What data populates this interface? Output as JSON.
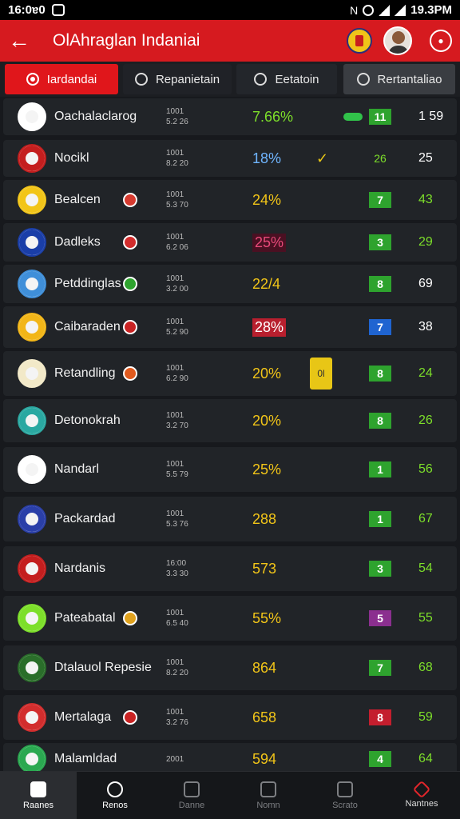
{
  "status_bar": {
    "time_left": "16:0ɐ0",
    "time_right": "19.3PM"
  },
  "app_bar": {
    "title": "OlAhraglan Indaniai"
  },
  "tabs": [
    {
      "label": "Iardandai"
    },
    {
      "label": "Repanietain"
    },
    {
      "label": "Eetatoin"
    },
    {
      "label": "Rertantaliao"
    }
  ],
  "rows": [
    {
      "name": "Oachalaclarog",
      "meta1": "1001",
      "meta2": "5.2 26",
      "pct": "7.66%",
      "pct_color": "#7ddf2a",
      "pct_bg": "",
      "badge": "11",
      "badge_color": "#2ea32e",
      "num": "1 59",
      "num_color": "#ffffff",
      "logo_color": "#ffffff",
      "flag_color": "",
      "extra_color": "#31c24a"
    },
    {
      "name": "Nocikl",
      "meta1": "1001",
      "meta2": "8.2 20",
      "pct": "18%",
      "pct_color": "#6fb5ff",
      "pct_bg": "",
      "badge": "26",
      "badge_color": "",
      "num": "25",
      "num_color": "#ffffff",
      "logo_color": "#c41e1e",
      "flag_color": "",
      "extra_color": ""
    },
    {
      "name": "Bealcen",
      "meta1": "1001",
      "meta2": "5.3 70",
      "pct": "24%",
      "pct_color": "#f2c518",
      "pct_bg": "",
      "badge": "7",
      "badge_color": "#2ea32e",
      "num": "43",
      "num_color": "#7ddf2a",
      "logo_color": "#f2c518",
      "flag_color": "#d63a2f",
      "extra_color": ""
    },
    {
      "name": "Dadleks",
      "meta1": "1001",
      "meta2": "6.2 06",
      "pct": "25%",
      "pct_color": "#e84a7a",
      "pct_bg": "#4a1022",
      "badge": "3",
      "badge_color": "#2ea32e",
      "num": "29",
      "num_color": "#7ddf2a",
      "logo_color": "#1a3ea8",
      "flag_color": "#d22d2d",
      "extra_color": ""
    },
    {
      "name": "Petddinglas",
      "meta1": "1001",
      "meta2": "3.2 00",
      "pct": "22/4",
      "pct_color": "#f2c518",
      "pct_bg": "",
      "badge": "8",
      "badge_color": "#2ea32e",
      "num": "69",
      "num_color": "#ffffff",
      "logo_color": "#3f8fd9",
      "flag_color": "#2ea32e",
      "extra_color": ""
    },
    {
      "name": "Caibaraden",
      "meta1": "1001",
      "meta2": "5.2 90",
      "pct": "28%",
      "pct_color": "#ffffff",
      "pct_bg": "#b81f2e",
      "badge": "7",
      "badge_color": "#1f64d1",
      "num": "38",
      "num_color": "#ffffff",
      "logo_color": "#f2b618",
      "flag_color": "#c92323",
      "extra_color": ""
    },
    {
      "name": "Retandling",
      "meta1": "1001",
      "meta2": "6.2 90",
      "pct": "20%",
      "pct_color": "#f2c518",
      "pct_bg": "",
      "badge": "8",
      "badge_color": "#2ea32e",
      "num": "24",
      "num_color": "#7ddf2a",
      "logo_color": "#f2e9c8",
      "flag_color": "#e05a1e",
      "extra_color": "",
      "mid": "0l"
    },
    {
      "name": "Detonokrah",
      "meta1": "1001",
      "meta2": "3.2 70",
      "pct": "20%",
      "pct_color": "#f2c518",
      "pct_bg": "",
      "badge": "8",
      "badge_color": "#2ea32e",
      "num": "26",
      "num_color": "#7ddf2a",
      "logo_color": "#2aa8a1",
      "flag_color": "",
      "extra_color": ""
    },
    {
      "name": "Nandarl",
      "meta1": "1001",
      "meta2": "5.5 79",
      "pct": "25%",
      "pct_color": "#f2c518",
      "pct_bg": "",
      "badge": "1",
      "badge_color": "#2ea32e",
      "num": "56",
      "num_color": "#7ddf2a",
      "logo_color": "#ffffff",
      "flag_color": "",
      "extra_color": ""
    },
    {
      "name": "Packardad",
      "meta1": "1001",
      "meta2": "5.3 76",
      "pct": "288",
      "pct_color": "#f2c518",
      "pct_bg": "",
      "badge": "1",
      "badge_color": "#2ea32e",
      "num": "67",
      "num_color": "#7ddf2a",
      "logo_color": "#2a3fa8",
      "flag_color": "",
      "extra_color": ""
    },
    {
      "name": "Nardanis",
      "meta1": "16:00",
      "meta2": "3.3 30",
      "pct": "573",
      "pct_color": "#f2c518",
      "pct_bg": "",
      "badge": "3",
      "badge_color": "#2ea32e",
      "num": "54",
      "num_color": "#7ddf2a",
      "logo_color": "#c41e1e",
      "flag_color": "",
      "extra_color": ""
    },
    {
      "name": "Pateabatal",
      "meta1": "1001",
      "meta2": "6.5 40",
      "pct": "55%",
      "pct_color": "#f2c518",
      "pct_bg": "",
      "badge": "5",
      "badge_color": "#8b2f8f",
      "num": "55",
      "num_color": "#7ddf2a",
      "logo_color": "#7ddf2a",
      "flag_color": "#e0a21e",
      "extra_color": ""
    },
    {
      "name": "Dtalauol Repesie",
      "meta1": "1001",
      "meta2": "8.2 20",
      "pct": "864",
      "pct_color": "#f2c518",
      "pct_bg": "",
      "badge": "7",
      "badge_color": "#2ea32e",
      "num": "68",
      "num_color": "#7ddf2a",
      "logo_color": "#2a6e2a",
      "flag_color": "",
      "extra_color": ""
    },
    {
      "name": "Mertalaga",
      "meta1": "1001",
      "meta2": "3.2 76",
      "pct": "658",
      "pct_color": "#f2c518",
      "pct_bg": "",
      "badge": "8",
      "badge_color": "#c41e2e",
      "num": "59",
      "num_color": "#7ddf2a",
      "logo_color": "#d22d2d",
      "flag_color": "#c92323",
      "extra_color": ""
    },
    {
      "name": "Malamldad",
      "meta1": "2001",
      "meta2": "",
      "pct": "594",
      "pct_color": "#f2c518",
      "pct_bg": "",
      "badge": "4",
      "badge_color": "#2ea32e",
      "num": "64",
      "num_color": "#7ddf2a",
      "logo_color": "#2aa850",
      "flag_color": "",
      "extra_color": ""
    }
  ],
  "bottom_nav": [
    {
      "label": "Raanes"
    },
    {
      "label": "Renos"
    },
    {
      "label": "Danne"
    },
    {
      "label": "Nomn"
    },
    {
      "label": "Scrato"
    },
    {
      "label": "Nantnes"
    }
  ]
}
